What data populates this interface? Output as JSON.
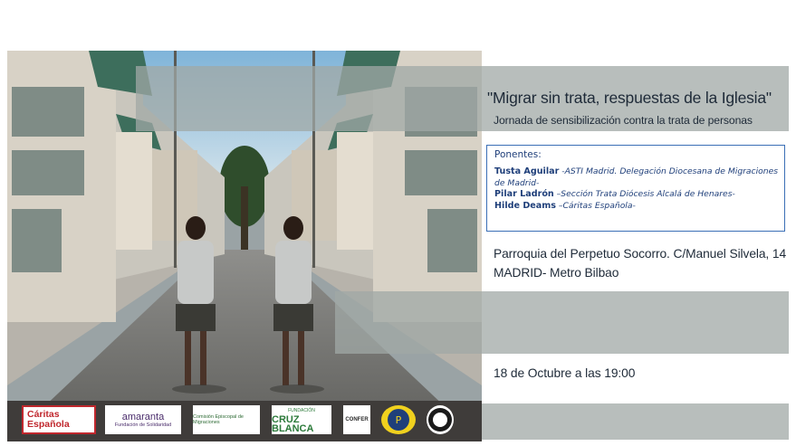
{
  "event": {
    "title": "\"Migrar sin trata, respuestas de la Iglesia\"",
    "subtitle": "Jornada de sensibilización contra la trata de personas"
  },
  "speakers": {
    "header": "Ponentes:",
    "items": [
      {
        "name": "Tusta Aguilar",
        "affiliation": " -ASTI Madrid. Delegación Diocesana de Migraciones de Madrid-"
      },
      {
        "name": "Pilar Ladrón",
        "affiliation": " –Sección Trata Diócesis Alcalá de Henares-"
      },
      {
        "name": "Hilde Deams",
        "affiliation": " –Cáritas Española-"
      }
    ]
  },
  "venue": {
    "line1": "Parroquia del Perpetuo Socorro. C/Manuel Silvela, 14",
    "line2": "MADRID- Metro Bilbao"
  },
  "datetime": "18 de Octubre a las 19:00",
  "logos": {
    "caritas": "Cáritas Española",
    "amaranta": "amaranta",
    "amaranta_sub": "Fundación de Solidaridad",
    "comision": "Comisión Episcopal de Migraciones",
    "cruz_blanca_top": "FUNDACIÓN",
    "cruz_blanca": "CRUZ BLANCA",
    "confer": "CONFER",
    "p4_icon": "p4-emblem-icon",
    "santa_icon": "santa-marta-seal-icon"
  },
  "colors": {
    "band": "#a0a8a6",
    "speaker_border": "#3b6fb6",
    "text": "#1e2a38",
    "caritas_red": "#c0272d"
  }
}
